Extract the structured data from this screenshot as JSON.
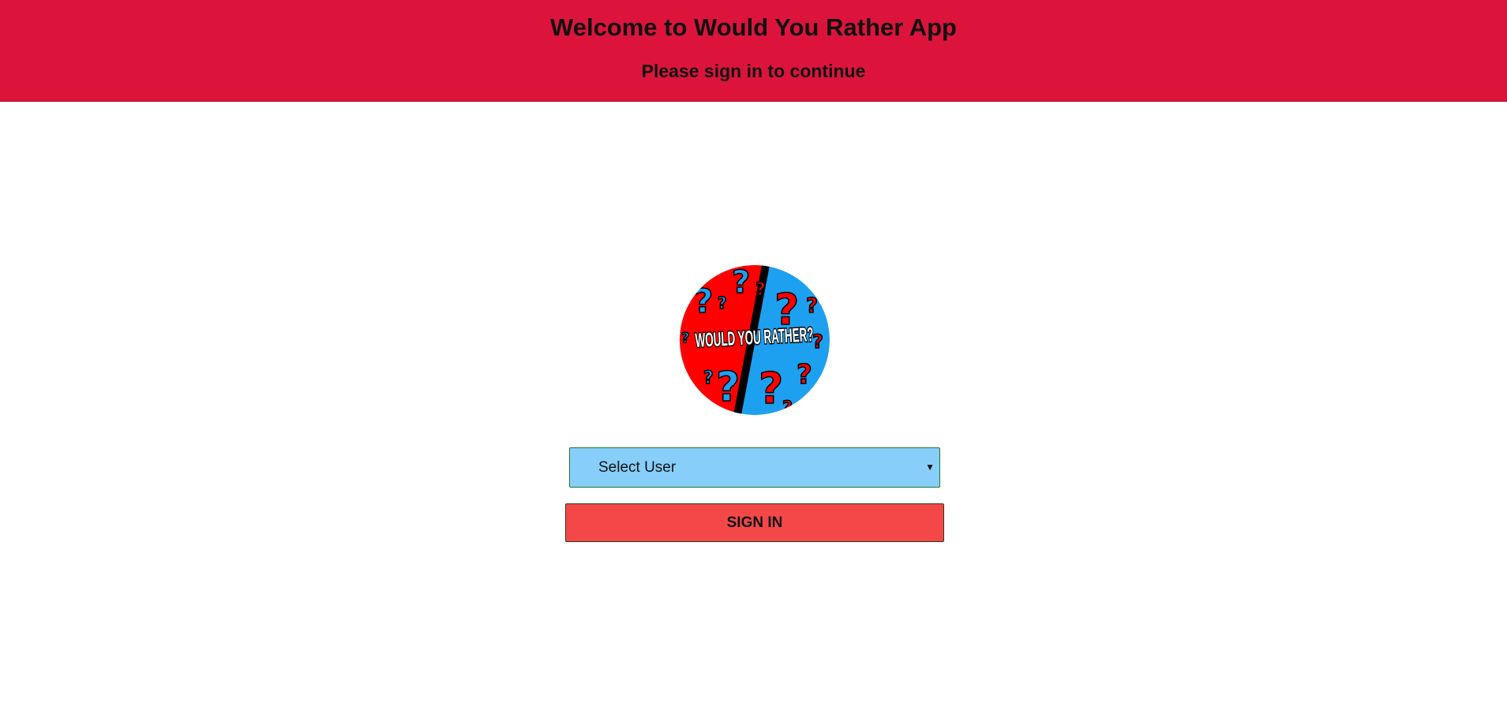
{
  "header": {
    "title": "Welcome to Would You Rather App",
    "subtitle": "Please sign in to continue"
  },
  "logo": {
    "text": "WOULD YOU RATHER?",
    "colors": {
      "left": "#FF0000",
      "right": "#1EA0F0"
    }
  },
  "form": {
    "select": {
      "selected": "Select User",
      "arrow_icon": "triangle-down"
    },
    "signin_label": "SIGN IN"
  },
  "colors": {
    "header_bg": "#DC143C",
    "select_bg": "#87CEFA",
    "button_bg": "#F44848"
  }
}
